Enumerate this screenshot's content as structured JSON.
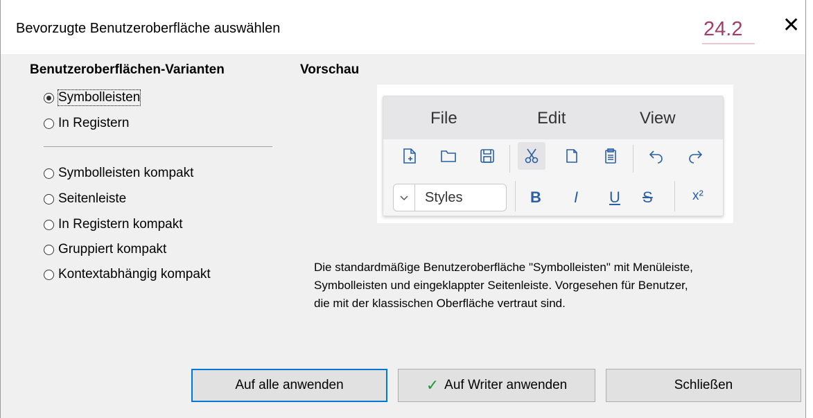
{
  "window": {
    "title": "Bevorzugte Benutzeroberfläche auswählen",
    "version_badge": "24.2"
  },
  "variants": {
    "heading": "Benutzeroberflächen-Varianten",
    "group1": [
      {
        "label": "Symbolleisten",
        "selected": true
      },
      {
        "label": "In Registern",
        "selected": false
      }
    ],
    "group2": [
      {
        "label": "Symbolleisten kompakt",
        "selected": false
      },
      {
        "label": "Seitenleiste",
        "selected": false
      },
      {
        "label": "In Registern kompakt",
        "selected": false
      },
      {
        "label": "Gruppiert kompakt",
        "selected": false
      },
      {
        "label": "Kontextabhängig kompakt",
        "selected": false
      }
    ]
  },
  "preview": {
    "heading": "Vorschau",
    "menus": [
      "File",
      "Edit",
      "View"
    ],
    "styles_label": "Styles",
    "format": {
      "bold": "B",
      "italic": "I",
      "underline": "U",
      "strike": "S",
      "superscript": "x²"
    }
  },
  "description": [
    "Die standardmäßige Benutzeroberfläche \"Symbolleisten\" mit Menüleiste,",
    "Symbolleisten und eingeklappter Seitenleiste. Vorgesehen für Benutzer,",
    "die mit der klassischen Oberfläche vertraut sind."
  ],
  "buttons": {
    "apply_all": "Auf alle anwenden",
    "apply_writer": "Auf Writer anwenden",
    "close": "Schließen"
  },
  "colors": {
    "accent": "#0078d7",
    "badge": "#a43d6a",
    "check": "#1a9a3a"
  }
}
